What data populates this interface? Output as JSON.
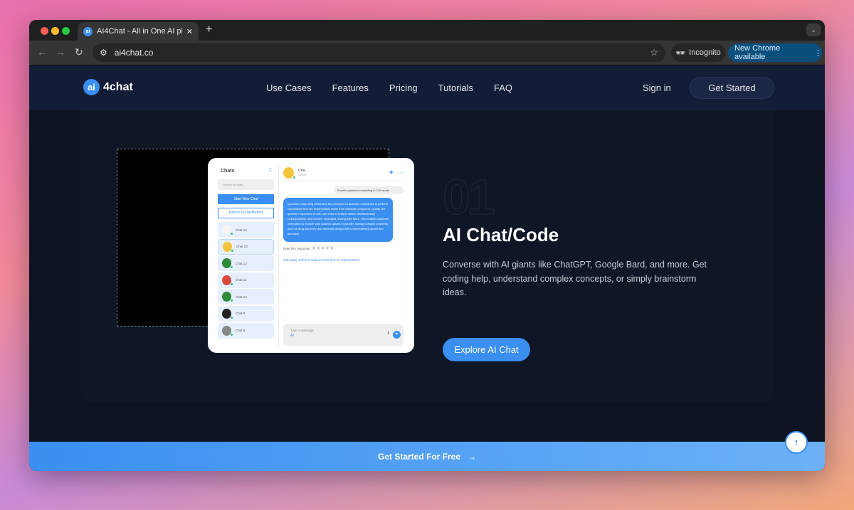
{
  "browser": {
    "tab_title": "AI4Chat - All in One AI platform",
    "url": "ai4chat.co",
    "incognito": "Incognito",
    "update": "New Chrome available"
  },
  "nav": {
    "logo_badge": "ai",
    "logo_text": "4chat",
    "links": [
      "Use Cases",
      "Features",
      "Pricing",
      "Tutorials",
      "FAQ"
    ],
    "sign_in": "Sign in",
    "get_started": "Get Started"
  },
  "mockup": {
    "title": "Chats",
    "search_placeholder": "Search all chats",
    "start_new": "Start New Chat",
    "return": "Return To Dashboard",
    "chats": [
      "Chat 14",
      "Chat 13",
      "Chat 12",
      "Chat 11",
      "Chat 10",
      "Chat 9",
      "Chat 8"
    ],
    "header_name": "Una...",
    "header_status": "Online",
    "user_msg": "Explain quantum computing in 100 words",
    "bot_msg": "Quantum computing harnesses the principles of quantum mechanics to perform calculations that are exponentially faster than classical computers. Qubits, the quantum equivalent of bits, can exist in multiple states simultaneously (superposition) and become entangled, linking their fates. This enables quantum computers to explore vast solution spaces in parallel, solving complex problems such as drug discovery and materials design with unprecedented speed and accuracy.",
    "rate": "Rate this response:",
    "regen": "Not happy with the output? Click here to regenerate it!",
    "input_placeholder": "Type a message",
    "ai_label": "AI"
  },
  "feature": {
    "number": "01",
    "title": "AI Chat/Code",
    "description": "Converse with AI giants like ChatGPT, Google Bard, and more. Get coding help, understand complex concepts, or simply brainstorm ideas.",
    "cta": "Explore AI Chat"
  },
  "footer_bar": {
    "label": "Get Started For Free",
    "arrow": "→"
  },
  "colors": {
    "accent": "#3a8ff0",
    "nav_bg": "#131d38",
    "page_bg": "#0d1320"
  }
}
